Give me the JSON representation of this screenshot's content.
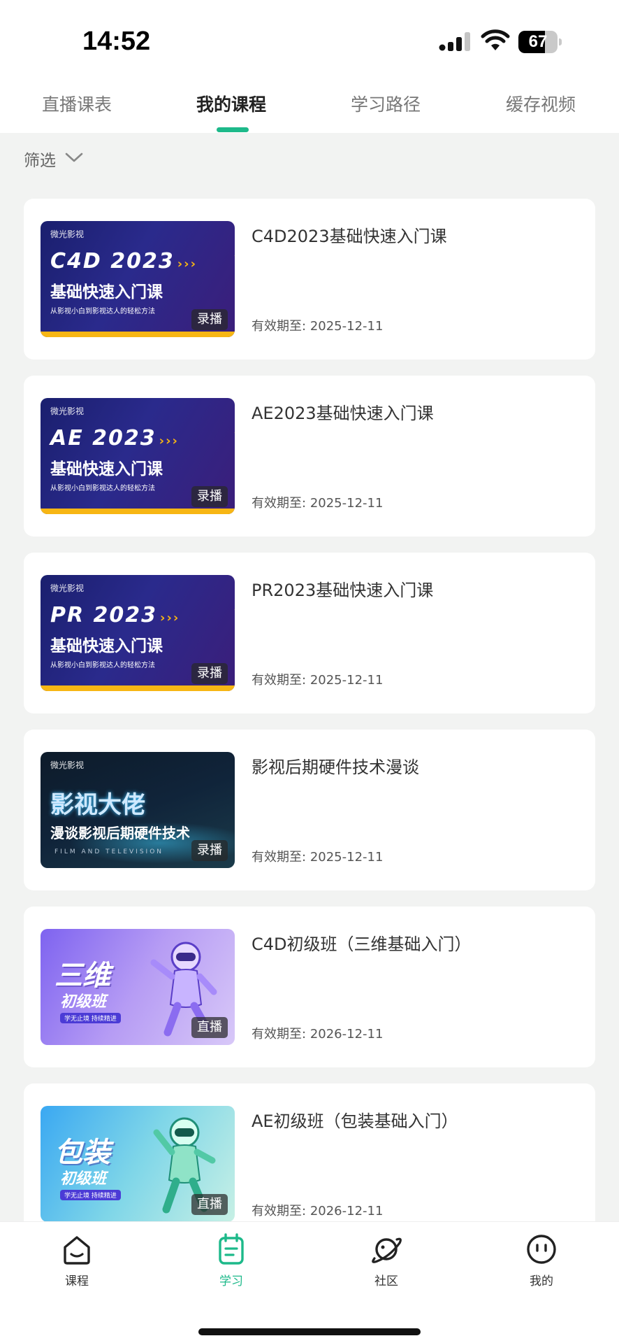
{
  "status_bar": {
    "time": "14:52",
    "battery": "67",
    "battery_level": 0.67
  },
  "tabs": [
    {
      "label": "直播课表",
      "active": false
    },
    {
      "label": "我的课程",
      "active": true
    },
    {
      "label": "学习路径",
      "active": false
    },
    {
      "label": "缓存视频",
      "active": false
    }
  ],
  "filter": {
    "label": "筛选"
  },
  "courses": [
    {
      "title": "C4D2023基础快速入门课",
      "expiry_label": "有效期至:",
      "expiry_date": "2025-12-11",
      "badge": "录播",
      "thumb": {
        "logo": "微光影视",
        "line1": "C4D 2023",
        "chevrons": "›››",
        "line2": "基础快速入门课",
        "line3": "从影视小白到影视达人的轻松方法"
      }
    },
    {
      "title": "AE2023基础快速入门课",
      "expiry_label": "有效期至:",
      "expiry_date": "2025-12-11",
      "badge": "录播",
      "thumb": {
        "logo": "微光影视",
        "line1": "AE 2023",
        "chevrons": "›››",
        "line2": "基础快速入门课",
        "line3": "从影视小白到影视达人的轻松方法"
      }
    },
    {
      "title": "PR2023基础快速入门课",
      "expiry_label": "有效期至:",
      "expiry_date": "2025-12-11",
      "badge": "录播",
      "thumb": {
        "logo": "微光影视",
        "line1": "PR 2023",
        "chevrons": "›››",
        "line2": "基础快速入门课",
        "line3": "从影视小白到影视达人的轻松方法"
      }
    },
    {
      "title": "影视后期硬件技术漫谈",
      "expiry_label": "有效期至:",
      "expiry_date": "2025-12-11",
      "badge": "录播",
      "thumb": {
        "logo": "微光影视",
        "line1": "影视大佬",
        "line2": "漫谈影视后期硬件技术",
        "line3": "FILM AND TELEVISION"
      }
    },
    {
      "title": "C4D初级班（三维基础入门）",
      "expiry_label": "有效期至:",
      "expiry_date": "2026-12-11",
      "badge": "直播",
      "thumb": {
        "line1": "三维",
        "line2": "初级班",
        "line3": "学无止境 持续精进"
      }
    },
    {
      "title": "AE初级班（包装基础入门）",
      "expiry_label": "有效期至:",
      "expiry_date": "2026-12-11",
      "badge": "直播",
      "thumb": {
        "line1": "包装",
        "line2": "初级班",
        "line3": "学无止境 持续精进"
      }
    }
  ],
  "bottom_nav": [
    {
      "label": "课程",
      "icon": "home-face-icon",
      "active": false
    },
    {
      "label": "学习",
      "icon": "notebook-icon",
      "active": true
    },
    {
      "label": "社区",
      "icon": "planet-icon",
      "active": false
    },
    {
      "label": "我的",
      "icon": "smiley-face-icon",
      "active": false
    }
  ],
  "colors": {
    "accent": "#1db98a",
    "thumb_yellow": "#f7b614"
  }
}
